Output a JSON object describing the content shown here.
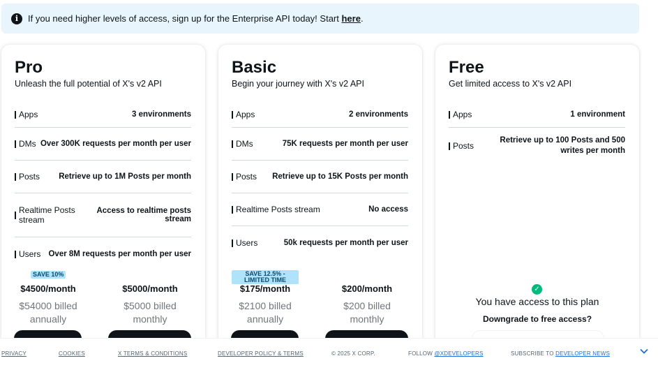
{
  "banner": {
    "icon": "info-icon",
    "text": "If you need higher levels of access, sign up for the Enterprise API today! Start ",
    "link": "here",
    "suffix": "."
  },
  "plans": [
    {
      "title": "Pro",
      "subtitle": "Unleash the full potential of X's v2 API",
      "features": [
        {
          "name": "Apps",
          "value": "3 environments"
        },
        {
          "name": "DMs",
          "value": "Over 300K requests per month per user"
        },
        {
          "name": "Posts",
          "value": "Retrieve up to 1M Posts per month"
        },
        {
          "name": "Realtime Posts stream",
          "value": "Access to realtime posts stream"
        },
        {
          "name": "Users",
          "value": "Over 8M requests per month per user"
        }
      ],
      "annual": {
        "badge": "SAVE 10%",
        "price": "$4500/month",
        "billed": "$54000 billed annually"
      },
      "monthly": {
        "price": "$5000/month",
        "billed": "$5000 billed monthly"
      }
    },
    {
      "title": "Basic",
      "subtitle": "Begin your journey with X's v2 API",
      "features": [
        {
          "name": "Apps",
          "value": "2 environments"
        },
        {
          "name": "DMs",
          "value": "75K requests per month per user"
        },
        {
          "name": "Posts",
          "value": "Retrieve up to 15K Posts per month"
        },
        {
          "name": "Realtime Posts stream",
          "value": "No access"
        },
        {
          "name": "Users",
          "value": "50k requests per month per user"
        }
      ],
      "annual": {
        "badge": "SAVE 12.5% - LIMITED TIME",
        "price": "$175/month",
        "billed": "$2100 billed annually"
      },
      "monthly": {
        "price": "$200/month",
        "billed": "$200 billed monthly"
      }
    },
    {
      "title": "Free",
      "subtitle": "Get limited access to X's v2 API",
      "features": [
        {
          "name": "Apps",
          "value": "1 environment"
        },
        {
          "name": "Posts",
          "value": "Retrieve up to 100 Posts and 500 writes per month"
        }
      ],
      "access_text": "You have access to this plan",
      "downgrade": "Downgrade to free access?"
    }
  ],
  "footer": {
    "privacy": "PRIVACY",
    "cookies": "COOKIES",
    "terms": "X TERMS & CONDITIONS",
    "policy": "DEVELOPER POLICY & TERMS",
    "copyright": "© 2025 X CORP.",
    "follow": "FOLLOW ",
    "follow_handle": "@XDEVELOPERS",
    "subscribe": "SUBSCRIBE TO ",
    "subscribe_link": "DEVELOPER NEWS"
  }
}
